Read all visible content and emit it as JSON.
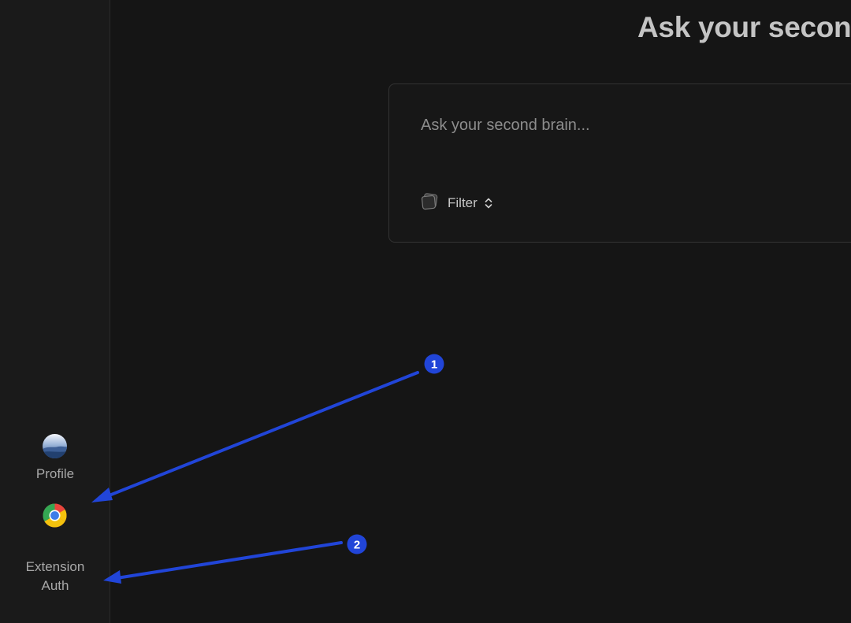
{
  "sidebar": {
    "profile_label": "Profile",
    "extension_label_line1": "Extension",
    "extension_label_line2": "Auth"
  },
  "main": {
    "title": "Ask your seconc",
    "search": {
      "placeholder": "Ask your second brain...",
      "value": ""
    },
    "filter_label": "Filter"
  },
  "annotations": [
    {
      "label": "1",
      "color": "#2145d8"
    },
    {
      "label": "2",
      "color": "#2145d8"
    }
  ],
  "icons": [
    "profile-avatar",
    "chrome-icon",
    "brain-stack-icon",
    "chevron-updown-icon"
  ]
}
